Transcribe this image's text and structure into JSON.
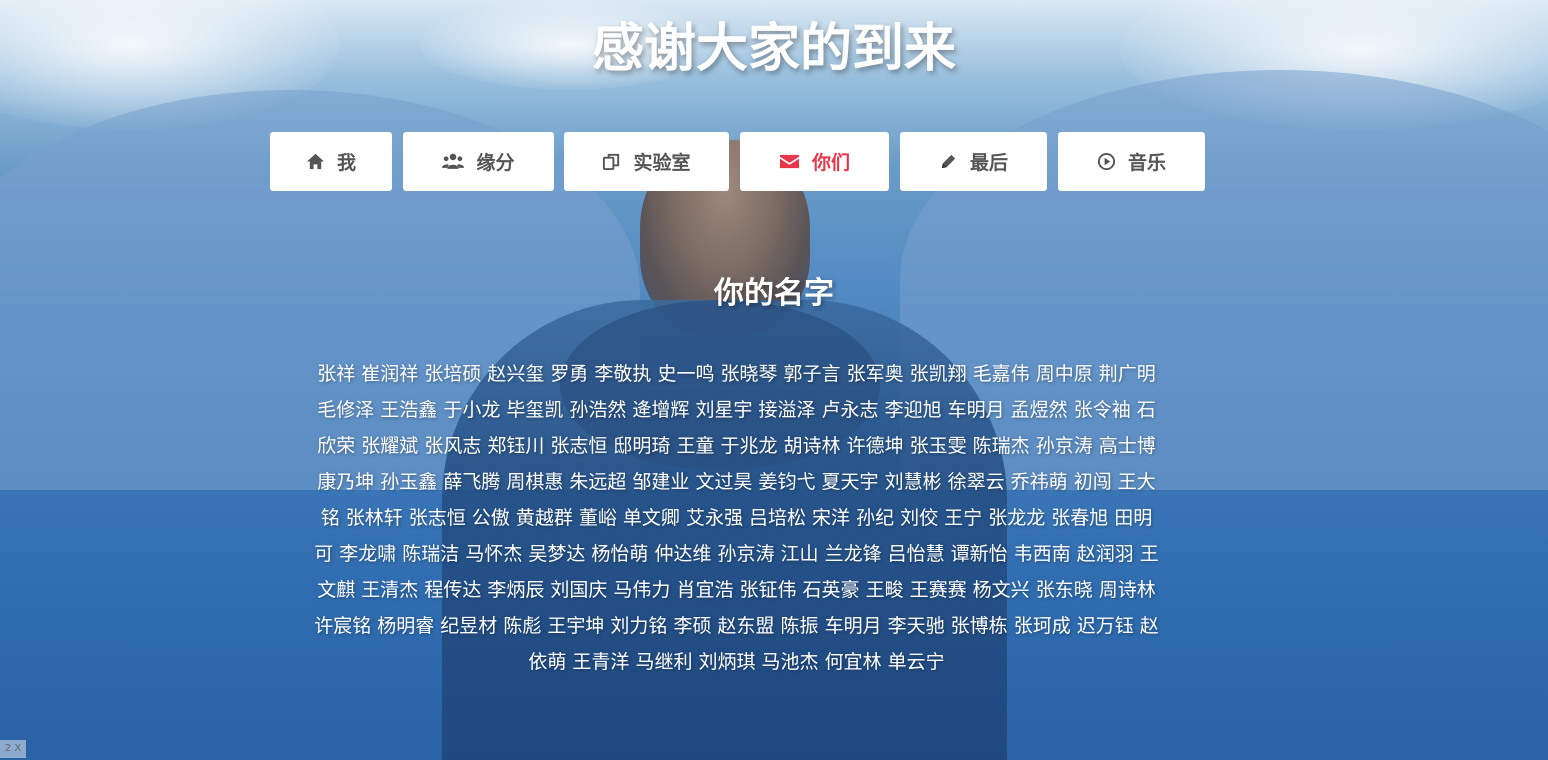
{
  "page": {
    "title": "感谢大家的到来"
  },
  "nav": {
    "items": [
      {
        "label": "我",
        "icon": "home-icon"
      },
      {
        "label": "缘分",
        "icon": "users-icon"
      },
      {
        "label": "实验室",
        "icon": "copy-icon"
      },
      {
        "label": "你们",
        "icon": "envelope-icon",
        "active": true
      },
      {
        "label": "最后",
        "icon": "pencil-icon"
      },
      {
        "label": "音乐",
        "icon": "play-circle-icon"
      }
    ],
    "active_color": "#e8364a"
  },
  "section": {
    "title": "你的名字",
    "names": "张祥 崔润祥 张培硕 赵兴玺 罗勇 李敬执 史一鸣 张晓琴 郭子言 张军奥 张凯翔 毛嘉伟 周中原 荆广明 毛修泽 王浩鑫 于小龙 毕玺凯 孙浩然 逄增辉 刘星宇 接溢泽 卢永志 李迎旭 车明月 孟煜然 张令袖 石欣荣 张耀斌 张风志 郑钰川 张志恒 邸明琦 王童 于兆龙 胡诗林 许德坤 张玉雯 陈瑞杰 孙京涛 高士博 康乃坤 孙玉鑫 薛飞腾 周棋惠 朱远超 邹建业 文过昊 姜钧弋 夏天宇 刘慧彬 徐翠云 乔祎萌 初闯 王大铭 张林轩 张志恒 公傲 黄越群 董峪 单文卿 艾永强 吕培松 宋洋 孙纪 刘佼 王宁 张龙龙 张春旭 田明可 李龙啸 陈瑞洁 马怀杰 吴梦达 杨怡萌 仲达维 孙京涛 江山 兰龙锋 吕怡慧 谭新怡 韦西南 赵润羽 王文麒 王清杰 程传达 李炳辰 刘国庆 马伟力 肖宜浩 张钲伟 石英豪 王畯 王赛赛 杨文兴 张东晓 周诗林 许宸铭 杨明睿 纪昱材 陈彪 王宇坤 刘力铭 李硕 赵东盟 陈振 车明月 李天驰 张博栋 张珂成 迟万钰 赵依萌 王青洋 马继利 刘炳琪 马池杰 何宜林 单云宁"
  },
  "corner": {
    "label": "2 X"
  }
}
